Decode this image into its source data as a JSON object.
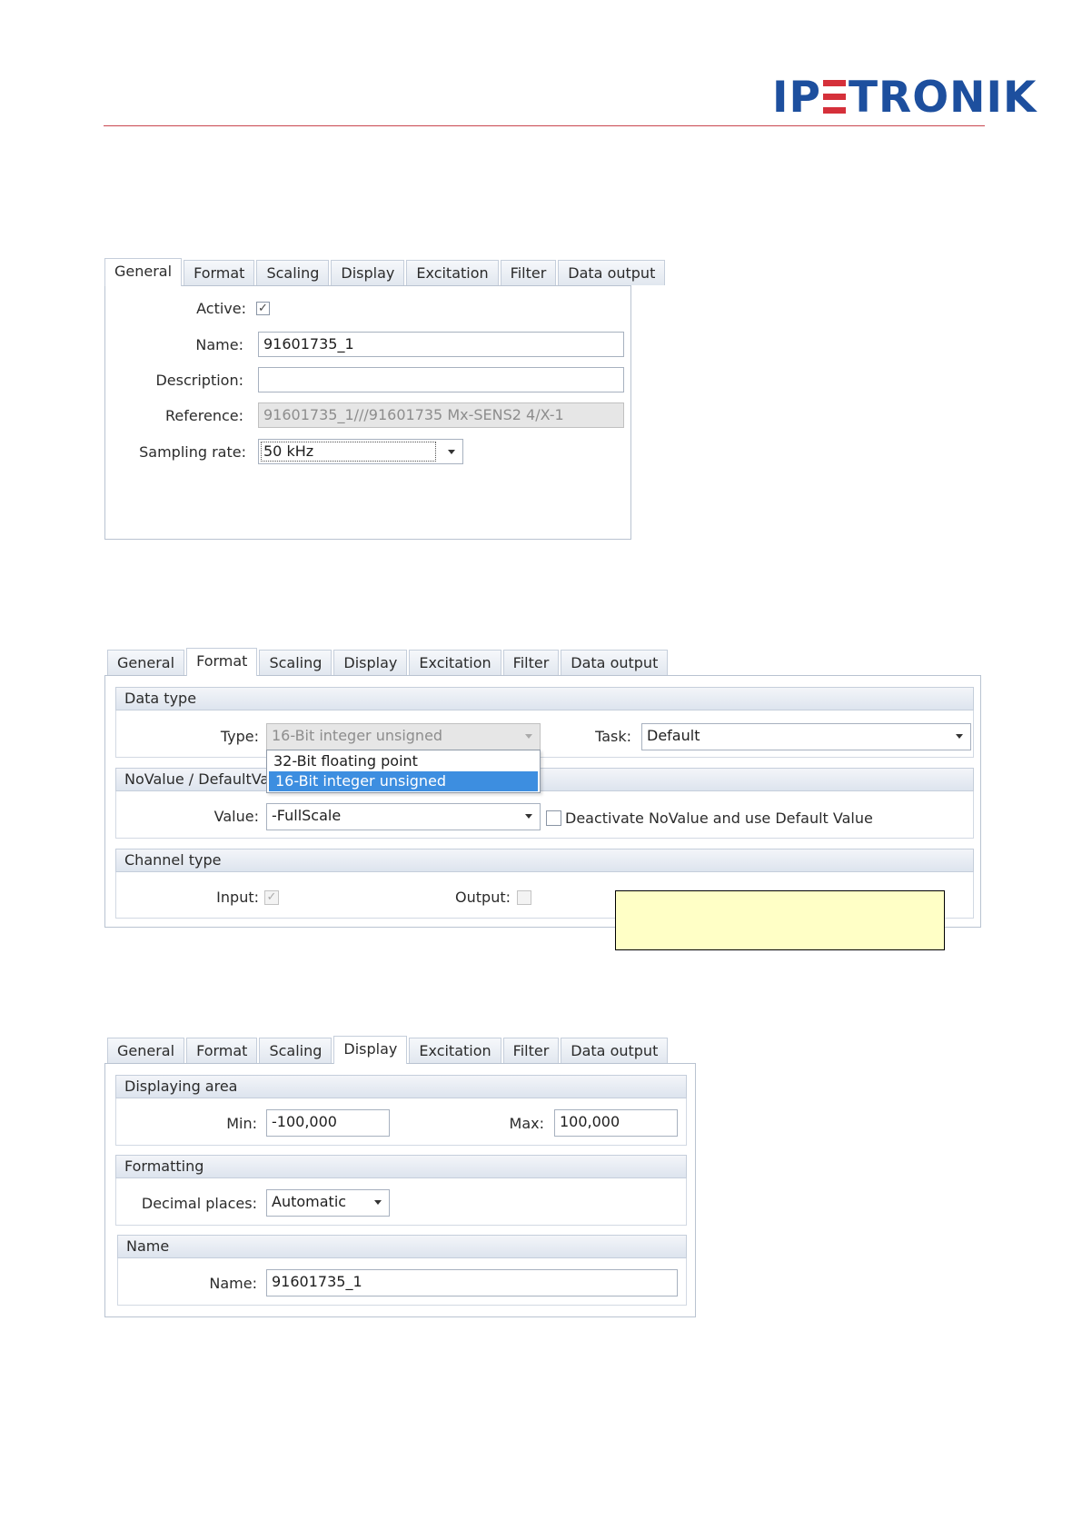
{
  "header": {
    "logo_text_left": "IP",
    "logo_text_right": "TRONIK",
    "brand_color": "#1d4f9e",
    "accent_color": "#d5303a"
  },
  "tabs": [
    "General",
    "Format",
    "Scaling",
    "Display",
    "Excitation",
    "Filter",
    "Data output"
  ],
  "panel_general": {
    "active_tab": "General",
    "active_label": "Active:",
    "active_checked": "✓",
    "name_label": "Name:",
    "name_value": "91601735_1",
    "description_label": "Description:",
    "description_value": "",
    "reference_label": "Reference:",
    "reference_value": "91601735_1///91601735 Mx-SENS2 4/X-1",
    "sampling_label": "Sampling rate:",
    "sampling_value": "50 kHz"
  },
  "panel_format": {
    "active_tab": "Format",
    "data_type_header": "Data type",
    "type_label": "Type:",
    "type_value": "16-Bit integer unsigned",
    "type_options": [
      "32-Bit floating point",
      "16-Bit integer unsigned"
    ],
    "task_label": "Task:",
    "task_value": "Default",
    "novalue_header": "NoValue / DefaultValu",
    "value_label": "Value:",
    "value_value": "-FullScale",
    "deactivate_label": "Deactivate NoValue and use Default Value",
    "channel_type_header": "Channel type",
    "input_label": "Input:",
    "input_checked": "✓",
    "output_label": "Output:",
    "selection_color": "#3d8ee0",
    "note_color": "#ffffc6"
  },
  "panel_display": {
    "active_tab": "Display",
    "displaying_area_header": "Displaying area",
    "min_label": "Min:",
    "min_value": "-100,000",
    "max_label": "Max:",
    "max_value": "100,000",
    "formatting_header": "Formatting",
    "decimal_label": "Decimal places:",
    "decimal_value": "Automatic",
    "name_header": "Name",
    "name_label": "Name:",
    "name_value": "91601735_1"
  }
}
